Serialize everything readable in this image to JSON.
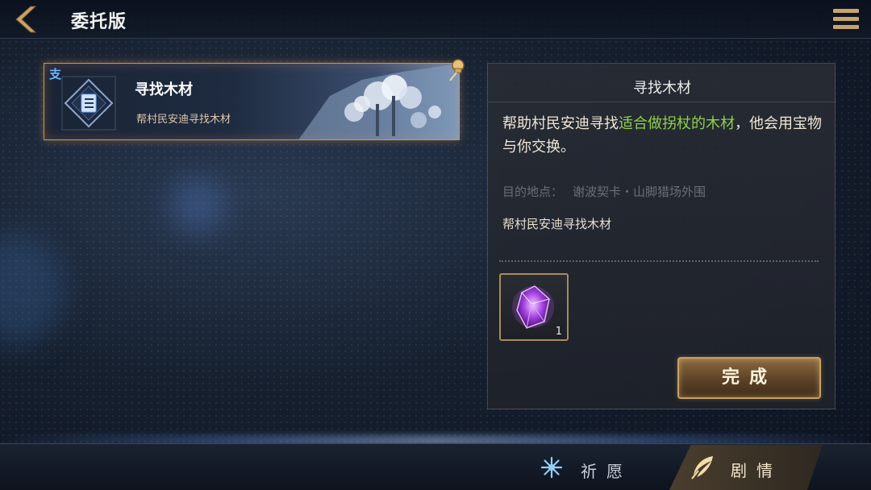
{
  "header": {
    "title": "委托版"
  },
  "quests": [
    {
      "type_tag": "支",
      "name": "寻找木材",
      "summary": "帮村民安迪寻找木材"
    }
  ],
  "detail": {
    "title": "寻找木材",
    "desc_before": "帮助村民安迪寻找",
    "desc_highlight": "适合做拐杖的木材",
    "desc_after": "，他会用宝物与你交换。",
    "destination_label": "目的地点：",
    "destination_value": "谢波契卡・山脚猎场外围",
    "summary": "帮村民安迪寻找木材",
    "reward": {
      "icon": "purple-crystal-icon",
      "count": "1"
    },
    "complete_label": "完成"
  },
  "bottom_nav": {
    "wish_label": "祈愿",
    "story_label": "剧情"
  },
  "colors": {
    "highlight": "#8fd04d",
    "card_border": "#c79a5c",
    "button_border": "#c9a064"
  }
}
